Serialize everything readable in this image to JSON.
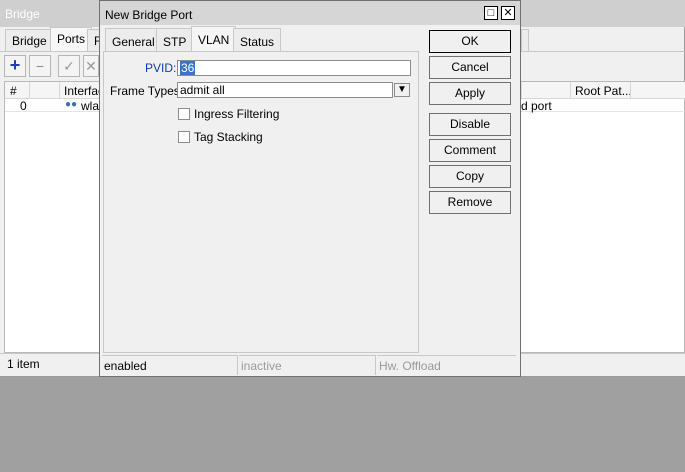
{
  "background_window": {
    "title": "Bridge",
    "tabs": [
      "Bridge",
      "Ports",
      "F"
    ],
    "active_tab_index": 1,
    "toolbar": {
      "add": "+",
      "remove": "−",
      "enable": "✓",
      "disable": "✕"
    },
    "columns": [
      "#",
      "Interface",
      "Root Pat..."
    ],
    "rows": [
      {
        "num": "0",
        "interface": "wlan",
        "role": "d port"
      }
    ],
    "status_text": "1 item"
  },
  "dialog": {
    "title": "New Bridge Port",
    "tabs": [
      "General",
      "STP",
      "VLAN",
      "Status"
    ],
    "active_tab": "VLAN",
    "pvid_label": "PVID:",
    "pvid_value": "36",
    "frame_types_label": "Frame Types:",
    "frame_types_value": "admit all",
    "ingress_filtering_label": "Ingress Filtering",
    "ingress_filtering_checked": false,
    "tag_stacking_label": "Tag Stacking",
    "tag_stacking_checked": false,
    "buttons": {
      "ok": "OK",
      "cancel": "Cancel",
      "apply": "Apply",
      "disable": "Disable",
      "comment": "Comment",
      "copy": "Copy",
      "remove": "Remove"
    },
    "status": {
      "enabled": "enabled",
      "inactive": "inactive",
      "hw_offload": "Hw. Offload"
    },
    "colors": {
      "selection": "#3a75c4",
      "pvid_label": "#0b3ea8",
      "add_icon": "#1a3fb8"
    }
  }
}
